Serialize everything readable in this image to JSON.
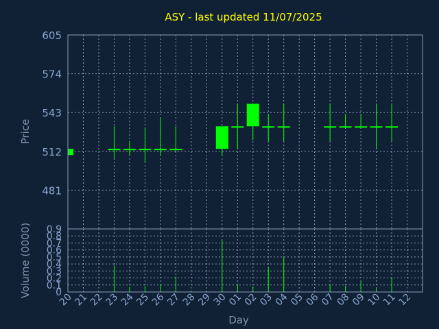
{
  "colors": {
    "background": "#102035",
    "title": "#ffff00",
    "candle": "#00ff00",
    "axis_text": "#8aa7cf",
    "grid": "#8aa0b8"
  },
  "chart_data": [
    {
      "type": "candlestick",
      "title": "ASY - last updated 11/07/2025",
      "ylabel": "Price",
      "ylim": [
        450,
        605
      ],
      "yticks": [
        "605",
        "574",
        "543",
        "512",
        "481"
      ],
      "ytick_values": [
        605,
        574,
        543,
        512,
        481
      ],
      "grid": true,
      "categories": [
        "20",
        "21",
        "22",
        "23",
        "24",
        "25",
        "26",
        "27",
        "28",
        "29",
        "30",
        "01",
        "02",
        "03",
        "04",
        "05",
        "06",
        "07",
        "08",
        "09",
        "10",
        "11",
        "12"
      ],
      "ohlc": [
        {
          "day": "20",
          "open": 514,
          "high": 514,
          "low": 509,
          "close": 509
        },
        {
          "day": "23",
          "open": 514,
          "high": 532,
          "low": 506,
          "close": 514
        },
        {
          "day": "24",
          "open": 514,
          "high": 520,
          "low": 509,
          "close": 514
        },
        {
          "day": "25",
          "open": 514,
          "high": 531,
          "low": 503,
          "close": 514
        },
        {
          "day": "26",
          "open": 514,
          "high": 539,
          "low": 509,
          "close": 514
        },
        {
          "day": "27",
          "open": 514,
          "high": 532,
          "low": 512,
          "close": 514
        },
        {
          "day": "30",
          "open": 514,
          "high": 532,
          "low": 509,
          "close": 532
        },
        {
          "day": "01",
          "open": 532,
          "high": 550,
          "low": 514,
          "close": 532
        },
        {
          "day": "02",
          "open": 532,
          "high": 550,
          "low": 521,
          "close": 550
        },
        {
          "day": "03",
          "open": 532,
          "high": 541,
          "low": 520,
          "close": 532
        },
        {
          "day": "04",
          "open": 532,
          "high": 550,
          "low": 520,
          "close": 532
        },
        {
          "day": "07",
          "open": 532,
          "high": 550,
          "low": 520,
          "close": 532
        },
        {
          "day": "08",
          "open": 532,
          "high": 541,
          "low": 532,
          "close": 532
        },
        {
          "day": "09",
          "open": 532,
          "high": 541,
          "low": 532,
          "close": 532
        },
        {
          "day": "10",
          "open": 532,
          "high": 550,
          "low": 514,
          "close": 532
        },
        {
          "day": "11",
          "open": 532,
          "high": 550,
          "low": 520,
          "close": 532
        }
      ]
    },
    {
      "type": "bar",
      "ylabel": "Volume (0000)",
      "xlabel": "Day",
      "ylim": [
        0,
        0.9
      ],
      "yticks": [
        "0.9",
        "0.8",
        "0.7",
        "0.6",
        "0.5",
        "0.4",
        "0.3",
        "0.2",
        "0.1",
        "0"
      ],
      "ytick_values": [
        0.9,
        0.8,
        0.7,
        0.6,
        0.5,
        0.4,
        0.3,
        0.2,
        0.1,
        0
      ],
      "categories": [
        "20",
        "21",
        "22",
        "23",
        "24",
        "25",
        "26",
        "27",
        "28",
        "29",
        "30",
        "01",
        "02",
        "03",
        "04",
        "05",
        "06",
        "07",
        "08",
        "09",
        "10",
        "11",
        "12"
      ],
      "values": [
        0,
        0,
        0,
        0.38,
        0.07,
        0.09,
        0.1,
        0.22,
        0,
        0,
        0.74,
        0.1,
        0.08,
        0.35,
        0.5,
        0,
        0,
        0.1,
        0.09,
        0.15,
        0.05,
        0.2,
        0
      ]
    }
  ]
}
